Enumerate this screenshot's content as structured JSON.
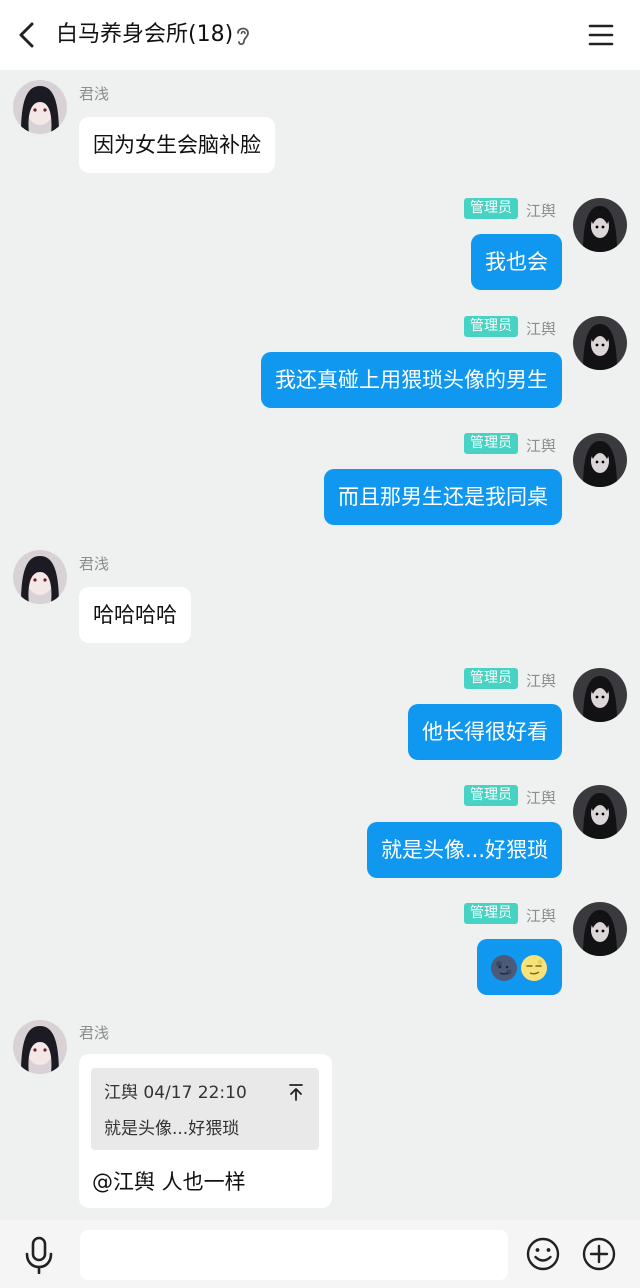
{
  "header": {
    "title": "白马养身会所(18)"
  },
  "messages": [
    {
      "name": "君浅",
      "text": "因为女生会脑补脸"
    },
    {
      "badge": "管理员",
      "name": "江舆",
      "text": "我也会"
    },
    {
      "badge": "管理员",
      "name": "江舆",
      "text": "我还真碰上用猥琐头像的男生"
    },
    {
      "badge": "管理员",
      "name": "江舆",
      "text": "而且那男生还是我同桌"
    },
    {
      "name": "君浅",
      "text": "哈哈哈哈"
    },
    {
      "badge": "管理员",
      "name": "江舆",
      "text": "他长得很好看"
    },
    {
      "badge": "管理员",
      "name": "江舆",
      "text": "就是头像...好猥琐"
    },
    {
      "badge": "管理员",
      "name": "江舆",
      "emojis": [
        "new-moon-face-icon",
        "full-moon-face-icon"
      ]
    },
    {
      "name": "君浅",
      "quote": {
        "header": "江舆 04/17 22:10",
        "text": "就是头像...好猥琐"
      },
      "text": "@江舆 人也一样"
    }
  ],
  "input": {
    "placeholder": ""
  },
  "colors": {
    "accent": "#1098f0",
    "badge": "#47d3c3",
    "background": "#eef1ef"
  }
}
